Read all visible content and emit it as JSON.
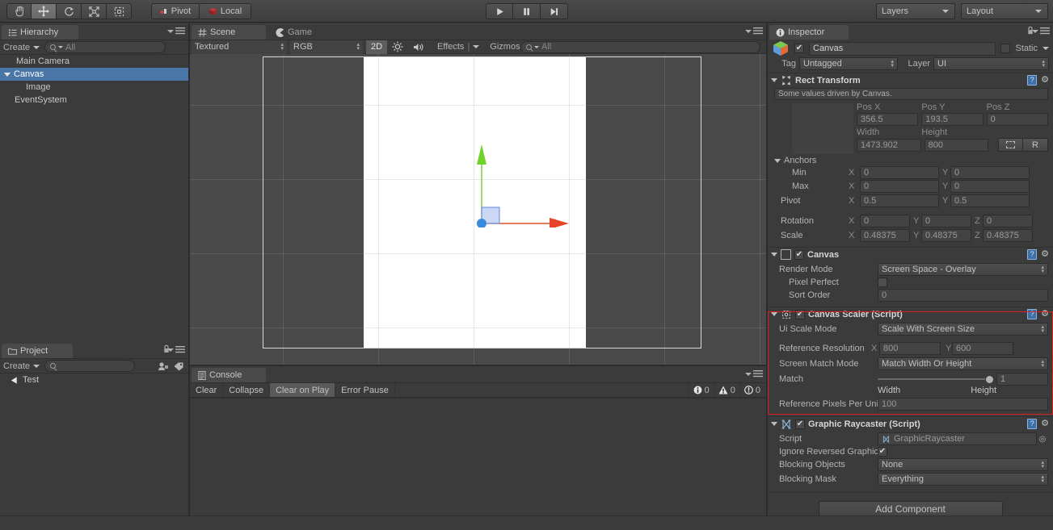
{
  "toolbar": {
    "tools": [
      {
        "name": "hand-tool",
        "icon": "hand-icon",
        "selected": false
      },
      {
        "name": "move-tool",
        "icon": "move-arrows-icon",
        "selected": true
      },
      {
        "name": "rotate-tool",
        "icon": "rotate-icon",
        "selected": false
      },
      {
        "name": "scale-tool",
        "icon": "scale-icon",
        "selected": false
      },
      {
        "name": "rect-tool",
        "icon": "rect-transform-icon",
        "selected": false
      }
    ],
    "pivot_label": "Pivot",
    "local_label": "Local",
    "play_label": "play-icon",
    "pause_label": "pause-icon",
    "step_label": "step-icon",
    "layers_label": "Layers",
    "layout_label": "Layout"
  },
  "hierarchy": {
    "tab_label": "Hierarchy",
    "create_label": "Create",
    "search_placeholder": "All",
    "items": [
      {
        "label": "Main Camera",
        "depth": 1,
        "expandable": false,
        "selected": false
      },
      {
        "label": "Canvas",
        "depth": 0,
        "expandable": true,
        "selected": true
      },
      {
        "label": "Image",
        "depth": 2,
        "expandable": false,
        "selected": false
      },
      {
        "label": "EventSystem",
        "depth": 1,
        "expandable": false,
        "selected": false
      }
    ]
  },
  "project": {
    "tab_label": "Project",
    "create_label": "Create",
    "search_value": "",
    "items": [
      {
        "label": "Test",
        "icon": "unity-asset-icon"
      }
    ]
  },
  "scene": {
    "tab_label": "Scene",
    "game_tab_label": "Game",
    "draw_mode": "Textured",
    "color_mode": "RGB",
    "mode_2d": "2D",
    "lighting_icon": "sun-icon",
    "audio_icon": "speaker-icon",
    "effects_label": "Effects",
    "gizmos_label": "Gizmos",
    "search_placeholder": "All"
  },
  "console": {
    "tab_label": "Console",
    "clear_label": "Clear",
    "collapse_label": "Collapse",
    "clear_on_play_label": "Clear on Play",
    "error_pause_label": "Error Pause",
    "log_count": "0",
    "warn_count": "0",
    "error_count": "0"
  },
  "inspector": {
    "tab_label": "Inspector",
    "lock_icon": "lock-icon",
    "menu_icon": "hamburger-menu-icon",
    "object_enabled": true,
    "object_name": "Canvas",
    "static_label": "Static",
    "static_checked": false,
    "tag_label": "Tag",
    "tag_value": "Untagged",
    "layer_label": "Layer",
    "layer_value": "UI",
    "rect_transform": {
      "title": "Rect Transform",
      "helpbox": "Some values driven by Canvas.",
      "pos_x_label": "Pos X",
      "pos_y_label": "Pos Y",
      "pos_z_label": "Pos Z",
      "pos_x": "356.5",
      "pos_y": "193.5",
      "pos_z": "0",
      "width_label": "Width",
      "height_label": "Height",
      "width": "1473.902",
      "height": "800",
      "blueprint_icon": "blueprint-rect-icon",
      "raw_label": "R",
      "anchors_label": "Anchors",
      "min_label": "Min",
      "max_label": "Max",
      "pivot_label": "Pivot",
      "rotation_label": "Rotation",
      "scale_label": "Scale",
      "x_label": "X",
      "y_label": "Y",
      "z_label": "Z",
      "anchor_min_x": "0",
      "anchor_min_y": "0",
      "anchor_max_x": "0",
      "anchor_max_y": "0",
      "pivot_x": "0.5",
      "pivot_y": "0.5",
      "rot_x": "0",
      "rot_y": "0",
      "rot_z": "0",
      "scale_x": "0.48375",
      "scale_y": "0.48375",
      "scale_z": "0.48375"
    },
    "canvas": {
      "title": "Canvas",
      "enabled": true,
      "render_mode_label": "Render Mode",
      "render_mode_value": "Screen Space - Overlay",
      "pixel_perfect_label": "Pixel Perfect",
      "pixel_perfect_checked": false,
      "sort_order_label": "Sort Order",
      "sort_order_value": "0"
    },
    "canvas_scaler": {
      "title": "Canvas Scaler (Script)",
      "enabled": true,
      "highlighted": true,
      "highlight_color": "#e02020",
      "ui_scale_mode_label": "Ui Scale Mode",
      "ui_scale_mode_value": "Scale With Screen Size",
      "reference_resolution_label": "Reference Resolution",
      "ref_x_label": "X",
      "ref_x_value": "800",
      "ref_y_label": "Y",
      "ref_y_value": "600",
      "screen_match_mode_label": "Screen Match Mode",
      "screen_match_mode_value": "Match Width Or Height",
      "match_label": "Match",
      "match_value": "1",
      "match_slider_pct": 100,
      "width_label": "Width",
      "height_label": "Height",
      "reference_pixels_label": "Reference Pixels Per Unit",
      "reference_pixels_value": "100"
    },
    "graphic_raycaster": {
      "title": "Graphic Raycaster (Script)",
      "enabled": true,
      "script_label": "Script",
      "script_value": "GraphicRaycaster",
      "ignore_reversed_label": "Ignore Reversed Graphics",
      "ignore_reversed_checked": true,
      "blocking_objects_label": "Blocking Objects",
      "blocking_objects_value": "None",
      "blocking_mask_label": "Blocking Mask",
      "blocking_mask_value": "Everything"
    },
    "add_component_label": "Add Component"
  }
}
